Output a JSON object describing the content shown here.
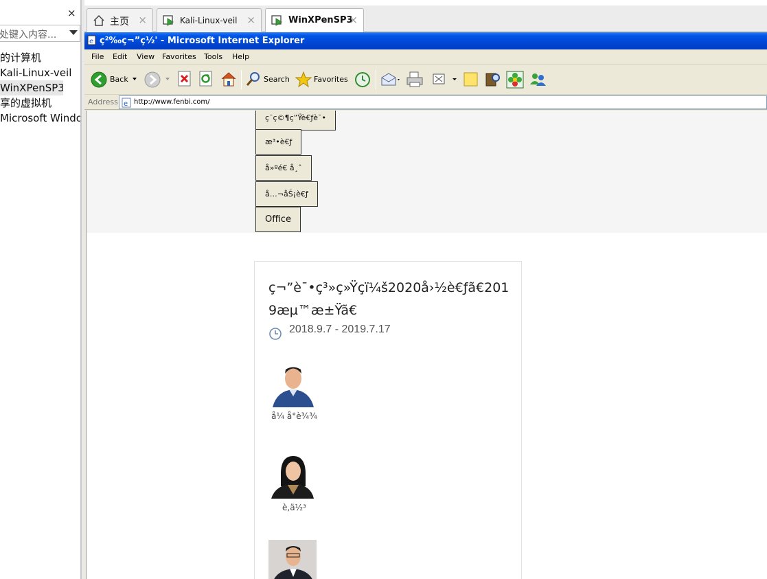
{
  "library_panel": {
    "close_glyph": "×",
    "search_placeholder": "处键入内容...",
    "tree_items": [
      "的计算机",
      "Kali-Linux-veil",
      "WinXPenSP3",
      "享的虚拟机",
      "Microsoft Windo"
    ]
  },
  "tabs": [
    {
      "label": "主页",
      "icon": "home-icon"
    },
    {
      "label": "Kali-Linux-veil",
      "icon": "vm-icon"
    },
    {
      "label": "WinXPenSP3",
      "icon": "vm-icon"
    }
  ],
  "tab_close_glyph": "×",
  "ie": {
    "title": "ç²‰ç¬”ç½' - Microsoft Internet Explorer",
    "menu": [
      "File",
      "Edit",
      "View",
      "Favorites",
      "Tools",
      "Help"
    ],
    "toolbar": {
      "back": "Back",
      "search": "Search",
      "favorites": "Favorites"
    },
    "address_label": "Address",
    "url": "http://www.fenbi.com/"
  },
  "page": {
    "nav_buttons": [
      "ç¨ç©¶ç”Ÿè€ƒè¯•",
      "æ³•è€ƒ",
      "å»ºé€ å¸ˆ",
      "å…¬åŠ¡è€ƒ",
      "Office"
    ],
    "card": {
      "title": "ç¬”è¯•ç³»ç»Ÿç­ï¼š2020å›½è€ƒã€2019æµ™æ±Ÿã€",
      "date": "2018.9.7 - 2019.7.17",
      "teachers": [
        {
          "name": "å¼ å°è¾¾"
        },
        {
          "name": "è,ä½³"
        }
      ]
    }
  },
  "colors": {
    "titlebar": "#0055e5",
    "xp_chrome": "#ece9d8",
    "nav_button_bg": "#ede9d9"
  }
}
